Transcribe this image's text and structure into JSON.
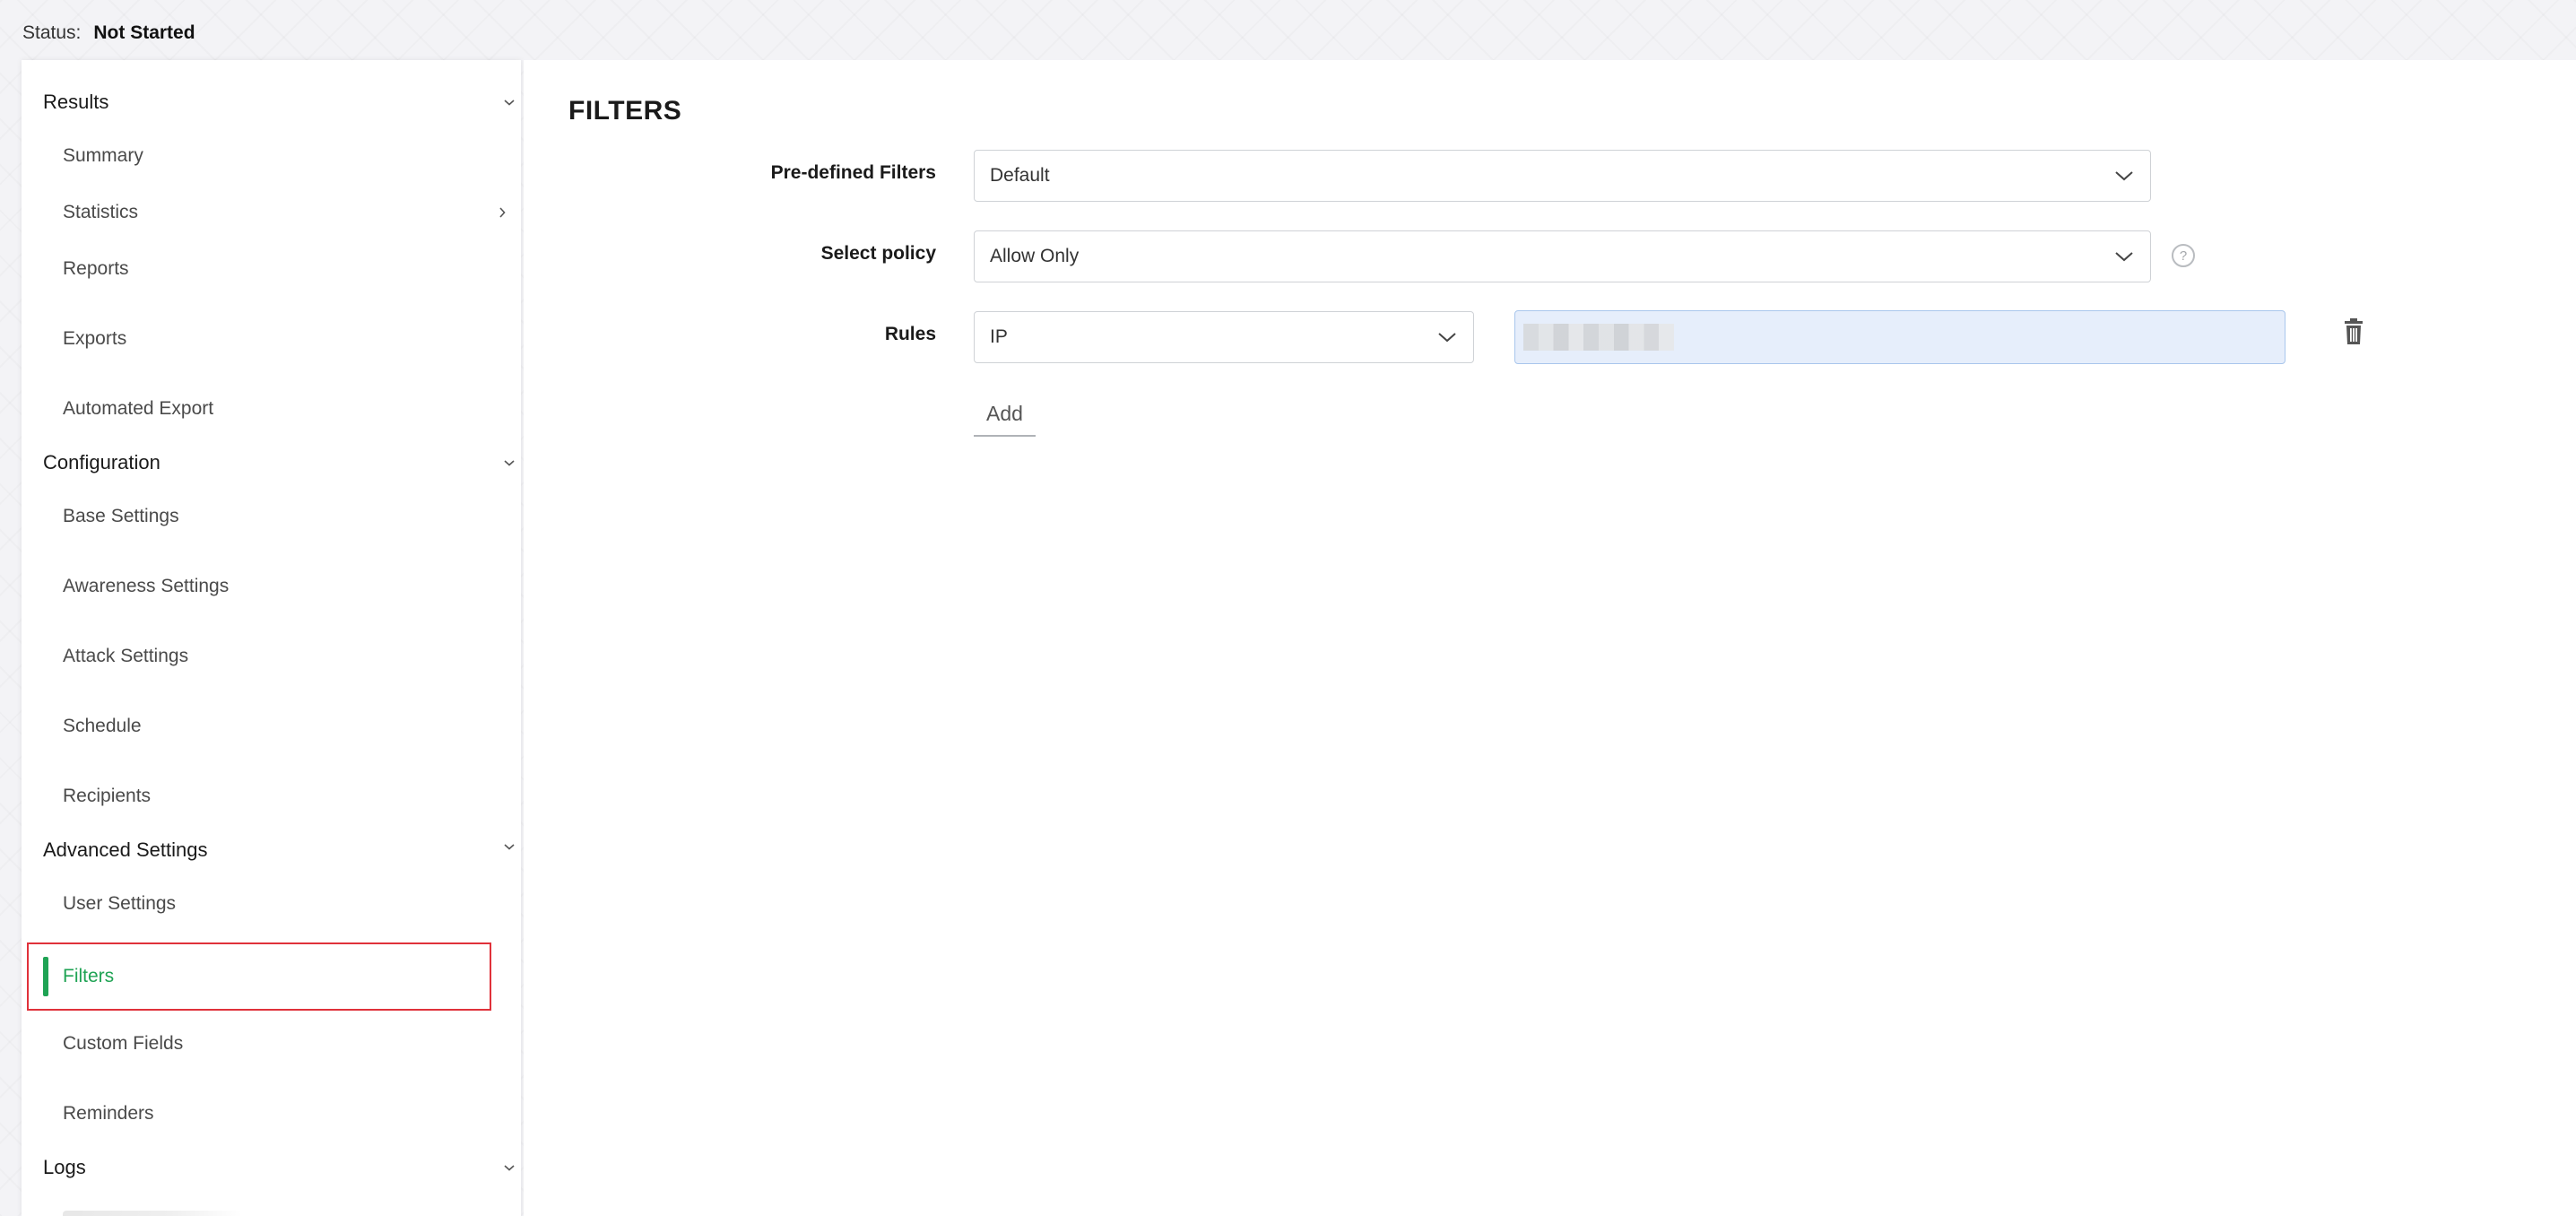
{
  "status": {
    "label": "Status:",
    "value": "Not Started"
  },
  "sidebar": {
    "sections": [
      {
        "title": "Results",
        "items": [
          "Summary",
          "Statistics",
          "Reports",
          "Exports",
          "Automated Export"
        ]
      },
      {
        "title": "Configuration",
        "items": [
          "Base Settings",
          "Awareness Settings",
          "Attack Settings",
          "Schedule",
          "Recipients"
        ]
      },
      {
        "title": "Advanced Settings",
        "items": [
          "User Settings",
          "Filters",
          "Custom Fields",
          "Reminders"
        ]
      },
      {
        "title": "Logs",
        "items": []
      }
    ],
    "active_item": "Filters"
  },
  "main": {
    "title": "FILTERS",
    "predefined_filters": {
      "label": "Pre-defined Filters",
      "value": "Default"
    },
    "select_policy": {
      "label": "Select policy",
      "value": "Allow Only",
      "help_glyph": "?"
    },
    "rules": {
      "label": "Rules",
      "type_value": "IP",
      "value": ""
    },
    "add_label": "Add"
  },
  "colors": {
    "accent_green": "#1fa354",
    "highlight_red": "#e0313a",
    "input_focus_bg": "#e6eefb"
  },
  "icons": {
    "chevron_down": "chevron-down-icon",
    "chevron_right": "chevron-right-icon",
    "help": "question-circle-icon",
    "delete": "trash-icon"
  }
}
